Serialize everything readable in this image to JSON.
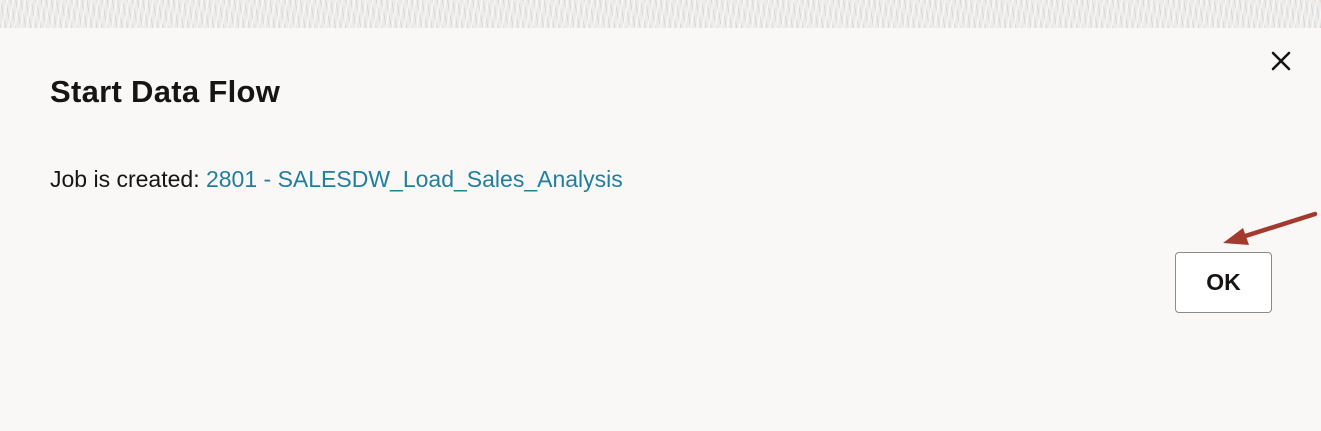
{
  "dialog": {
    "title": "Start Data Flow",
    "message_prefix": "Job is created: ",
    "job_link_text": "2801 - SALESDW_Load_Sales_Analysis",
    "ok_label": "OK",
    "close_icon": "close-icon"
  },
  "annotation": {
    "arrow_color": "#a33a2f",
    "points_to": "ok-button"
  },
  "colors": {
    "link": "#227e9e",
    "text": "#161513",
    "background": "#f9f8f7"
  }
}
